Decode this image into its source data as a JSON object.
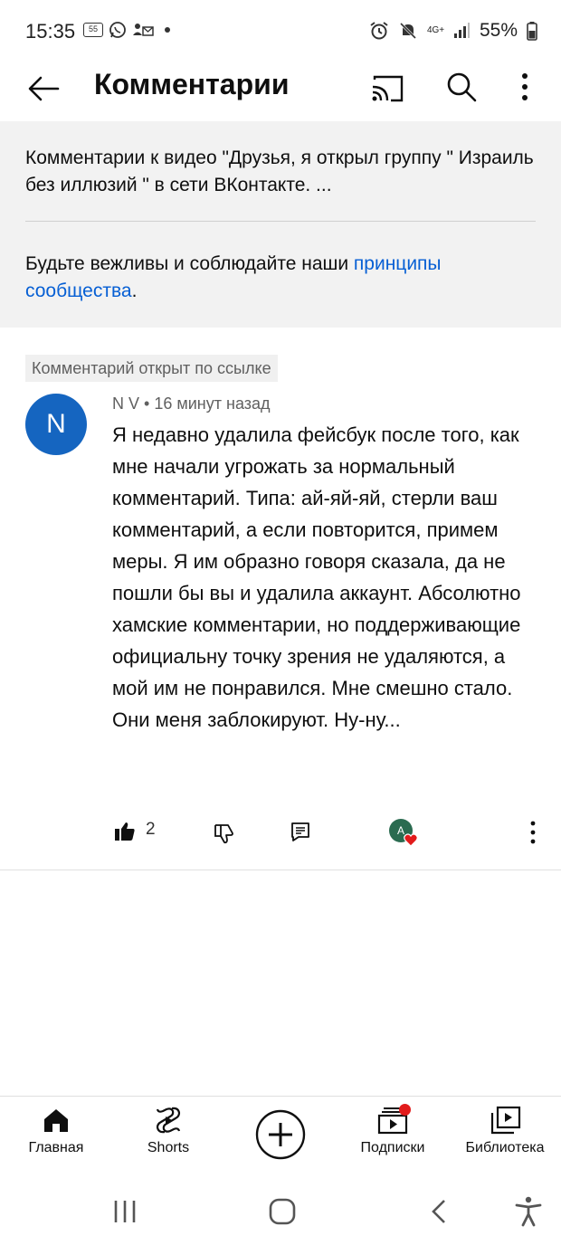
{
  "status_bar": {
    "time": "15:35",
    "box_icon_text": "55",
    "network": "4G+",
    "battery": "55%"
  },
  "app_bar": {
    "title": "Комментарии"
  },
  "info": {
    "video_description": "Комментарии к видео \"Друзья, я открыл группу \" Израиль без иллюзий \" в сети ВКонтакте.  ...",
    "rules_prefix": "Будьте вежливы и соблюдайте наши ",
    "rules_link": "принципы сообщества",
    "rules_suffix": "."
  },
  "comment": {
    "highlight_label": "Комментарий открыт по ссылке",
    "avatar_letter": "N",
    "author": "N V",
    "separator": "•",
    "time": "16 минут назад",
    "text": "Я недавно удалила фейсбук после того, как мне начали угрожать за нормальный комментарий. Типа: ай-яй-яй, стерли ваш комментарий, а если повторится, примем меры. Я им образно говоря сказала, да не пошли бы вы и удалила аккаунт. Абсолютно хамские комментарии, но поддерживающие официальну точку зрения не удаляются, а мой им не понравился. Мне смешно стало. Они меня заблокируют. Ну-ну...",
    "like_count": "2",
    "creator_avatar_letter": "A"
  },
  "bottom_nav": {
    "items": [
      {
        "label": "Главная",
        "icon": "home-icon"
      },
      {
        "label": "Shorts",
        "icon": "shorts-icon"
      },
      {
        "label": "",
        "icon": "create-icon"
      },
      {
        "label": "Подписки",
        "icon": "subscriptions-icon"
      },
      {
        "label": "Библиотека",
        "icon": "library-icon"
      }
    ]
  },
  "colors": {
    "link": "#065fd4",
    "avatar": "#1565c0",
    "badge": "#e21b1b",
    "panel": "#f2f2f2"
  }
}
